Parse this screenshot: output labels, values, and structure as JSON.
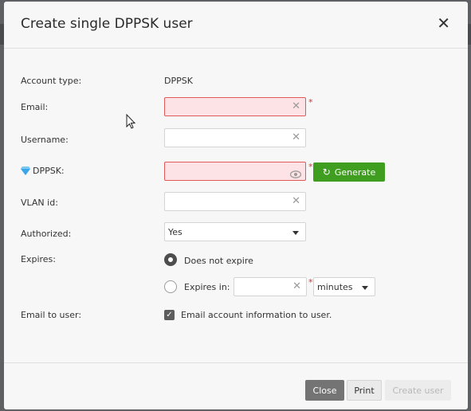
{
  "dialog": {
    "title": "Create single DPPSK user"
  },
  "form": {
    "account_type": {
      "label": "Account type:",
      "value": "DPPSK"
    },
    "email": {
      "label": "Email:",
      "value": ""
    },
    "username": {
      "label": "Username:",
      "value": ""
    },
    "dppsk": {
      "label": "DPPSK:",
      "value": "",
      "generate_label": "Generate"
    },
    "vlan": {
      "label": "VLAN id:",
      "value": ""
    },
    "authorized": {
      "label": "Authorized:",
      "selected": "Yes"
    },
    "expires": {
      "label": "Expires:",
      "option_never": "Does not expire",
      "option_in": "Expires in:",
      "amount": "",
      "unit": "minutes",
      "selected": "never"
    },
    "email_to_user": {
      "label": "Email to user:",
      "checkbox_label": "Email account information to user.",
      "checked": true
    }
  },
  "footer": {
    "close_label": "Close",
    "print_label": "Print",
    "create_label": "Create user"
  },
  "colors": {
    "generate_button": "#3f9e1f",
    "error_bg": "#fde3e6",
    "error_border": "#e05a5a",
    "close_button": "#747474"
  }
}
